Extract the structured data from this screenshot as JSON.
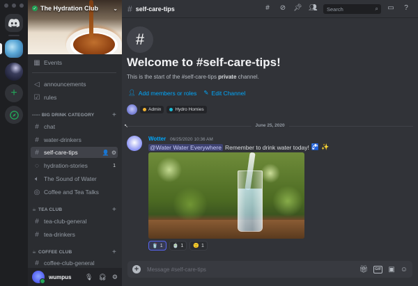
{
  "server": {
    "name": "The Hydration Club"
  },
  "sidebar": {
    "events_label": "Events",
    "channels": [
      {
        "label": "announcements",
        "icon": "announcement-icon"
      },
      {
        "label": "rules",
        "icon": "rules-icon"
      }
    ],
    "categories": [
      {
        "label": "----- BIG DRINK CATEGORY"
      },
      {
        "label": "TEA CLUB",
        "emoji": "☕"
      },
      {
        "label": "COFFEE CLUB",
        "emoji": "☕"
      }
    ],
    "big_drink": [
      {
        "label": "chat",
        "icon": "hash-icon"
      },
      {
        "label": "water-drinkers",
        "icon": "hash-icon"
      },
      {
        "label": "self-care-tips",
        "icon": "hash-icon",
        "active": true
      },
      {
        "label": "hydration-stories",
        "icon": "forum-icon",
        "count": "1"
      },
      {
        "label": "The Sound of Water",
        "icon": "voice-icon"
      },
      {
        "label": "Coffee and Tea Talks",
        "icon": "stage-icon"
      }
    ],
    "tea_club": [
      {
        "label": "tea-club-general",
        "icon": "hash-icon"
      },
      {
        "label": "tea-drinkers",
        "icon": "hash-icon"
      }
    ],
    "coffee_club": [
      {
        "label": "coffee-club-general",
        "icon": "hash-icon"
      }
    ]
  },
  "user": {
    "name": "wumpus"
  },
  "header": {
    "channel": "self-care-tips",
    "search_placeholder": "Search"
  },
  "welcome": {
    "title": "Welcome to #self-care-tips!",
    "sub_before": "This is the start of the #self-care-tips ",
    "sub_bold": "private",
    "sub_after": " channel.",
    "add_members": "Add members or roles",
    "edit_channel": "Edit Channel",
    "roles": [
      {
        "label": "Admin",
        "color": "#f0b232"
      },
      {
        "label": "Hydro Homies",
        "color": "#1abcd6"
      }
    ]
  },
  "divider_date": "June 25, 2020",
  "message": {
    "author": "Wotter",
    "timestamp": "06/25/2020 10:36 AM",
    "mention": "@Water Water Everywhere",
    "text": "Remember to drink water today!",
    "reactions": [
      {
        "emoji": "🥤",
        "count": "1"
      },
      {
        "emoji": "🍵",
        "count": "1"
      },
      {
        "emoji": "🙂",
        "count": "1"
      }
    ]
  },
  "composer": {
    "placeholder": "Message #self-care-tips"
  },
  "colors": {
    "accent": "#5865f2",
    "link": "#00a8fc",
    "online": "#23a559"
  }
}
